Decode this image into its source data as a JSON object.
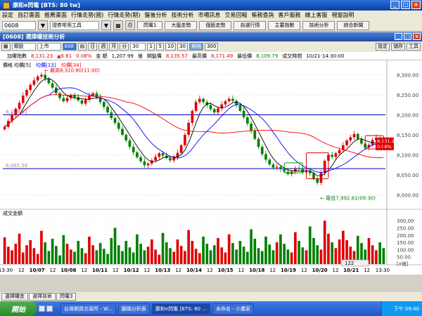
{
  "app": {
    "title": "康和e閃電 [BTS: 80 tw]",
    "window_controls": [
      "_",
      "□",
      "×"
    ]
  },
  "menu": [
    "設定",
    "自訂畫面",
    "推薦畫面",
    "行情走勢(國)",
    "行情走勢(期)",
    "盤後分析",
    "技術分析",
    "市場訊息",
    "交易回報",
    "帳務查詢",
    "客戶服務",
    "線上客服",
    "視窗說明"
  ],
  "toolbar": {
    "code_value": "0608",
    "tool_select": "證券常用工具",
    "buttons": [
      "閃電1",
      "大盤走勢",
      "個股走勢",
      "自選行情",
      "主要指數",
      "技術分析",
      "綜合新聞"
    ]
  },
  "window": {
    "title": "[0608] 選擇權技術分析"
  },
  "controls": {
    "type_select": "類股",
    "market_select": "上市",
    "id_select": "608",
    "periods": [
      "日",
      "週",
      "月",
      "分"
    ],
    "minute_value": "30",
    "intervals": [
      "1",
      "5",
      "10",
      "30"
    ],
    "interval_extra": [
      "期限",
      "300"
    ],
    "right_buttons": [
      "設定",
      "儲存",
      "工具"
    ]
  },
  "info": {
    "index_label": "加權指數",
    "price": "8,131.23",
    "change": "▲6.61",
    "change_pct": "0.08%",
    "amount_label": "金 額",
    "amount": "1,207.99",
    "amount_unit": "億",
    "open_label": "開盤價",
    "open": "8,135.57",
    "high_label": "最高價",
    "high": "8,171.49",
    "low_label": "最低價",
    "low": "8,109.79",
    "time_label": "成交時間",
    "time": "10/21-14:30:00"
  },
  "chart_data": {
    "type": "candlestick",
    "series": [
      {
        "name": "價格",
        "type": "candlestick"
      },
      {
        "name": "均價[5]",
        "type": "line",
        "color": "#000000"
      },
      {
        "name": "均價[13]",
        "type": "line",
        "color": "#0000ff"
      },
      {
        "name": "均價[34]",
        "type": "line",
        "color": "#ff0000"
      }
    ],
    "legend_text": [
      "價格",
      "均價[5]",
      "均價[13]",
      "均價[34]"
    ],
    "ylim": [
      7985,
      8315
    ],
    "y_ticks": [
      "8,300.00",
      "8,250.00",
      "8,200.00",
      "8,150.00",
      "8,100.00",
      "8,050.00",
      "8,000.00"
    ],
    "y_tick_values": [
      8300,
      8250,
      8200,
      8150,
      8100,
      8050,
      8000
    ],
    "x_labels": [
      "13:30",
      "12",
      "10/07",
      "12",
      "10/08",
      "12",
      "10/11",
      "12",
      "10/12",
      "12",
      "10/13",
      "12",
      "10/14",
      "12",
      "10/15",
      "12",
      "10/18",
      "12",
      "10/19",
      "12",
      "10/20",
      "12",
      "10/21",
      "12",
      "13:30"
    ],
    "hlines": [
      {
        "label": "8,199.92",
        "value": 8199.92,
        "color": "#0000c0"
      },
      {
        "label": "8,065.56",
        "value": 8065.56,
        "color": "#0000c0"
      }
    ],
    "annotations": [
      {
        "text": "最高8,310.80(11:00)",
        "value": 8310.8
      },
      {
        "text": "最低7,992.81(09:30)",
        "value": 7992.81
      }
    ],
    "last_price_box": [
      "8,131.23",
      "0.08%"
    ],
    "closes": [
      8170,
      8185,
      8200,
      8215,
      8230,
      8248,
      8262,
      8275,
      8286,
      8296,
      8300,
      8291,
      8279,
      8268,
      8254,
      8242,
      8234,
      8242,
      8250,
      8244,
      8236,
      8228,
      8238,
      8248,
      8254,
      8244,
      8232,
      8220,
      8206,
      8192,
      8180,
      8165,
      8150,
      8136,
      8120,
      8106,
      8094,
      8084,
      8074,
      8078,
      8086,
      8095,
      8104,
      8098,
      8092,
      8086,
      8094,
      8105,
      8124,
      8150,
      8180,
      8210,
      8232,
      8240,
      8232,
      8224,
      8214,
      8206,
      8216,
      8226,
      8234,
      8240,
      8235,
      8224,
      8210,
      8194,
      8178,
      8160,
      8140,
      8120,
      8102,
      8088,
      8076,
      8068,
      8070,
      8064,
      8058,
      8052,
      8058,
      8066,
      8064,
      8056,
      8060,
      8054,
      8040,
      8030,
      8055,
      8085,
      8100,
      8095,
      8104,
      8112,
      8124,
      8136,
      8144,
      8152,
      8140,
      8128,
      8118,
      8125,
      8137,
      8143,
      8135,
      8131
    ],
    "volume": {
      "title": "成交金額",
      "ylim": [
        0,
        330
      ],
      "y_ticks": [
        "300.00",
        "250.00",
        "200.00",
        "150.00",
        "100.00",
        "50.00"
      ],
      "y_tick_values": [
        300,
        250,
        200,
        150,
        100,
        50
      ],
      "unit": "[x億]",
      "values": [
        185,
        120,
        95,
        140,
        210,
        80,
        130,
        165,
        110,
        70,
        230,
        150,
        90,
        175,
        125,
        60,
        200,
        140,
        100,
        85,
        160,
        110,
        75,
        190,
        130,
        95,
        145,
        105,
        70,
        180,
        250,
        130,
        90,
        160,
        115,
        80,
        205,
        140,
        95,
        120,
        170,
        100,
        65,
        215,
        150,
        110,
        85,
        170,
        125,
        90,
        235,
        160,
        105,
        75,
        190,
        140,
        95,
        130,
        180,
        115,
        80,
        205,
        145,
        100,
        160,
        120,
        85,
        240,
        175,
        110,
        90,
        190,
        135,
        95,
        150,
        205,
        140,
        100,
        80,
        220,
        160,
        115,
        95,
        260,
        180,
        130,
        100,
        300,
        210,
        150,
        110,
        170,
        230,
        165,
        120,
        90,
        195,
        145,
        100,
        180,
        130,
        95,
        150,
        110
      ]
    },
    "scroll_value": "122"
  },
  "bottom_tabs": [
    "選擇權走",
    "選擇技術",
    "閃電3"
  ],
  "taskbar": {
    "start": "開始",
    "items": [
      "台灣期貨交易所 - W...",
      "圖碼分析表",
      "康和e閃電 [BTS: 80 ...",
      "未命名 - 小畫家"
    ],
    "clock": "下午 09:40"
  }
}
